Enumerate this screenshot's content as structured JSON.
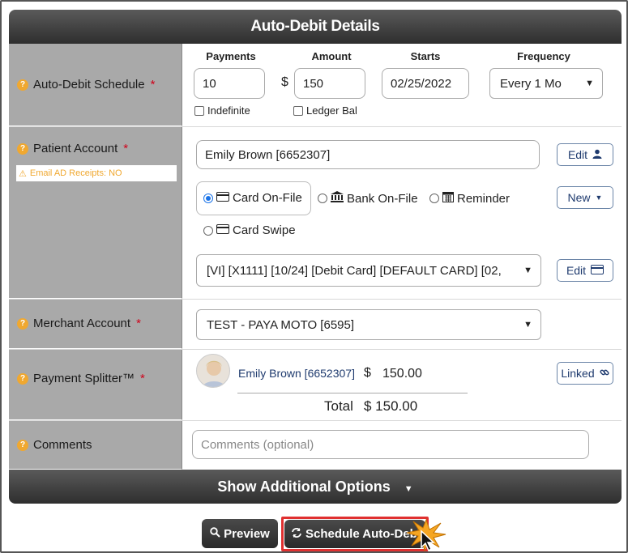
{
  "title": "Auto-Debit Details",
  "schedule": {
    "label": "Auto-Debit Schedule",
    "payments_header": "Payments",
    "amount_header": "Amount",
    "starts_header": "Starts",
    "frequency_header": "Frequency",
    "payments_value": "10",
    "currency": "$",
    "amount_value": "150",
    "starts_value": "02/25/2022",
    "frequency_value": "Every 1 Mo",
    "indefinite_label": "Indefinite",
    "ledger_label": "Ledger Bal"
  },
  "patient": {
    "label": "Patient Account",
    "warning": "Email AD Receipts: NO",
    "account_value": "Emily Brown [6652307]",
    "edit_label": "Edit",
    "new_label": "New",
    "method_card_onfile": "Card On-File",
    "method_bank_onfile": "Bank On-File",
    "method_reminder": "Reminder",
    "method_card_swipe": "Card Swipe",
    "selected_method": "Card On-File",
    "card_value": "[VI] [X1111] [10/24] [Debit Card] [DEFAULT CARD] [02,",
    "card_edit_label": "Edit"
  },
  "merchant": {
    "label": "Merchant Account",
    "value": "TEST - PAYA MOTO [6595]"
  },
  "splitter": {
    "label": "Payment Splitter™",
    "name": "Emily Brown [6652307]",
    "currency": "$",
    "amount": "150.00",
    "linked_label": "Linked",
    "total_label": "Total",
    "total_value": "$ 150.00"
  },
  "comments": {
    "label": "Comments",
    "placeholder": "Comments (optional)"
  },
  "additional_options_label": "Show Additional Options",
  "preview_label": "Preview",
  "schedule_button_label": "Schedule Auto-Debit",
  "colors": {
    "accent_required": "#d0021b",
    "help_icon": "#f0a830",
    "header_dark": "#2e2e2e",
    "highlight_border": "#e03030"
  }
}
